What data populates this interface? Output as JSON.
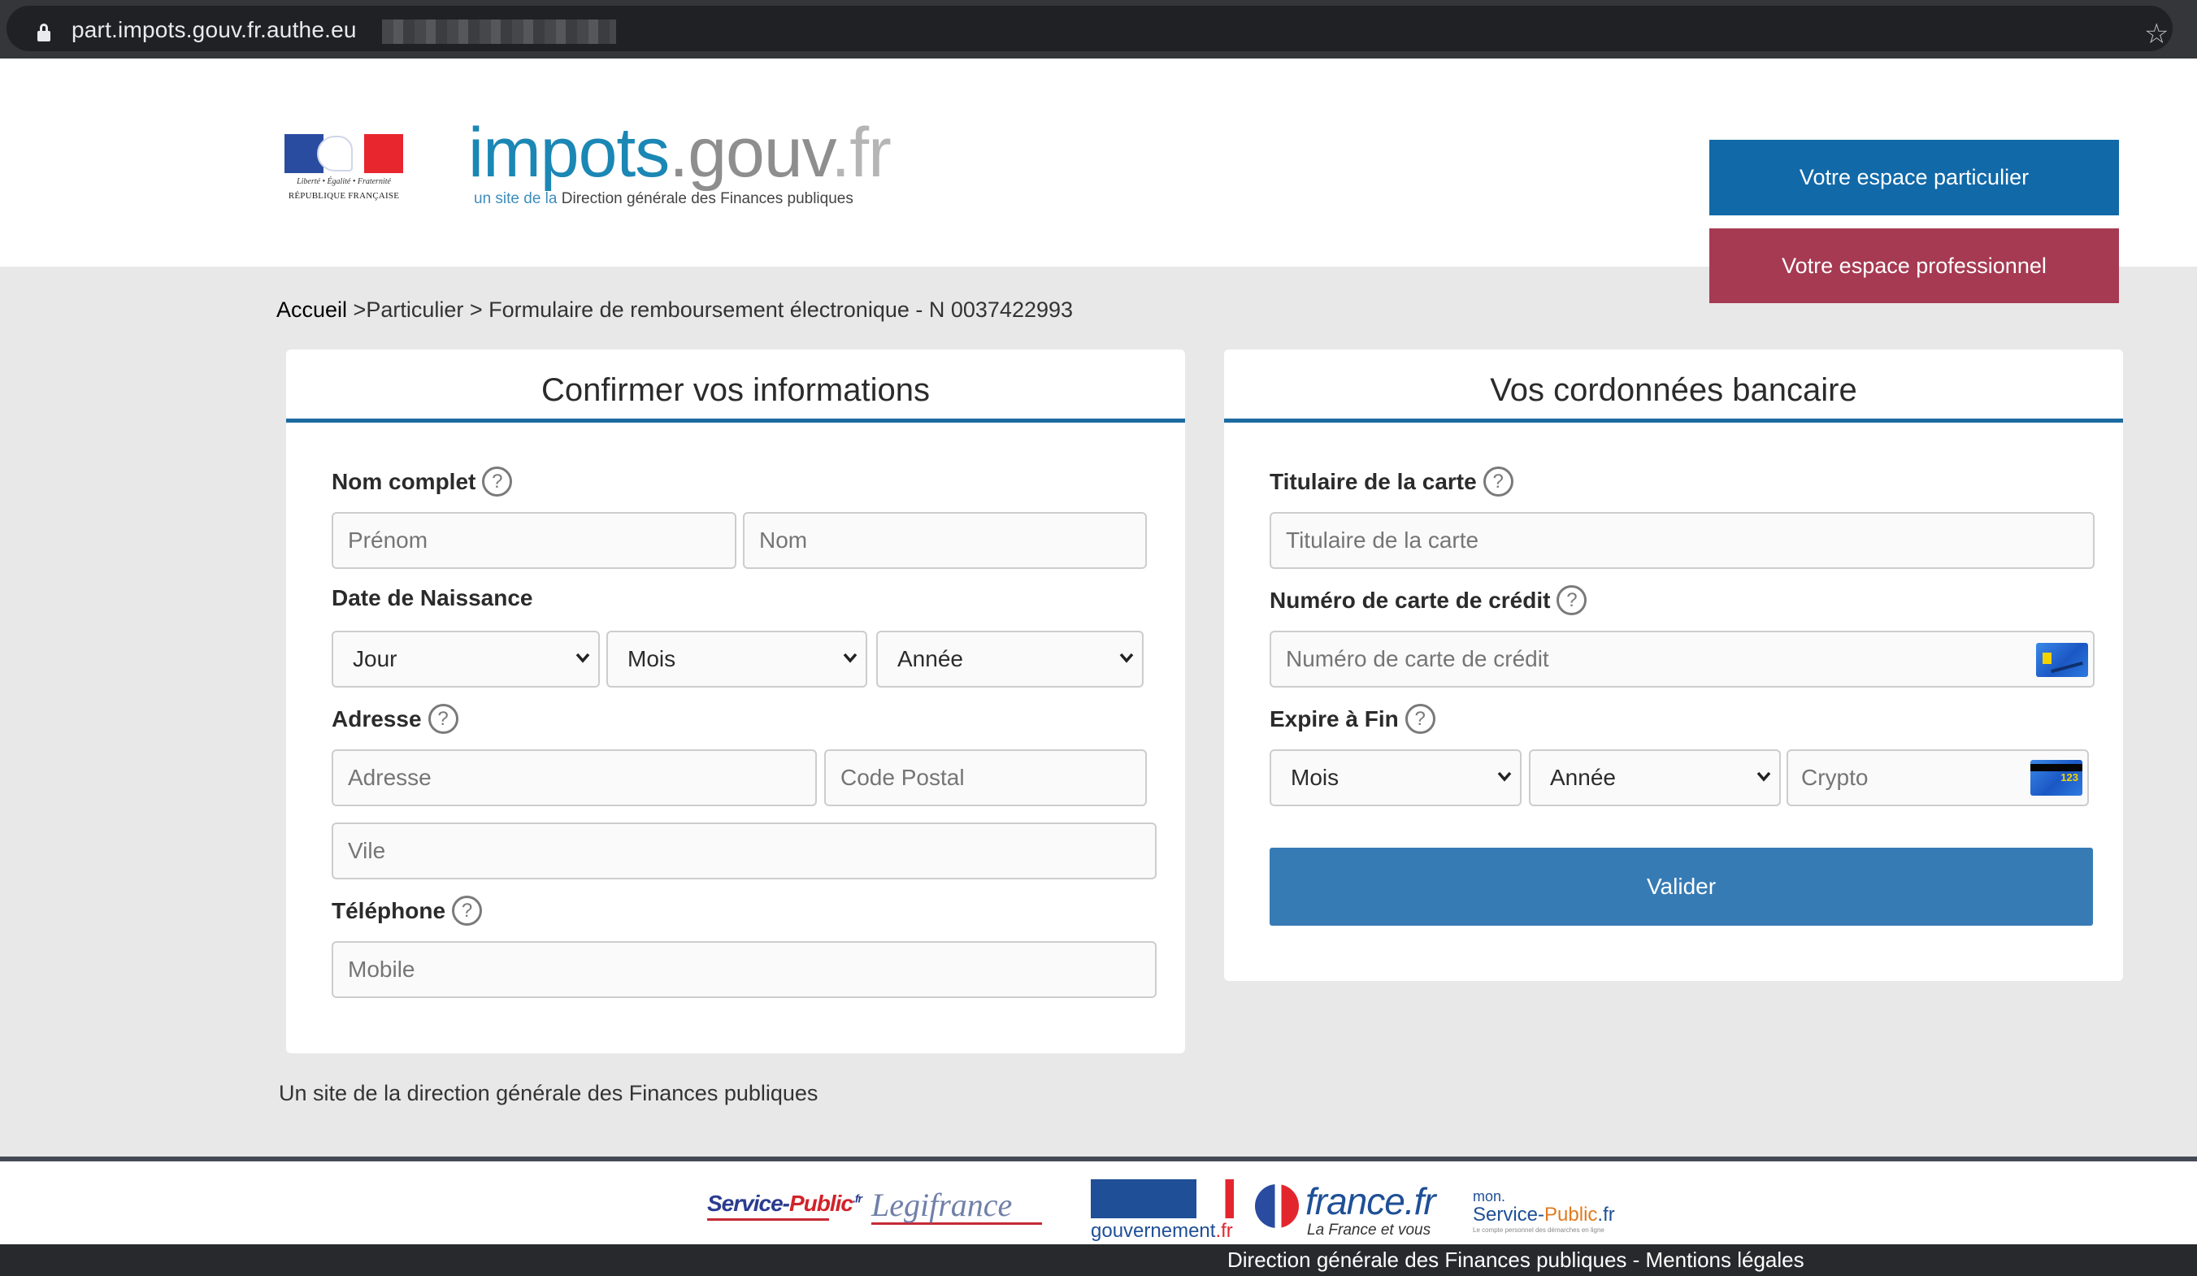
{
  "browser": {
    "url": "part.impots.gouv.fr.authe.eu",
    "url_redacted": true,
    "lock_icon": "lock-icon",
    "bookmark_icon": "star-icon"
  },
  "header": {
    "republic_logo": {
      "motto": "Liberté • Égalité • Fraternité",
      "name": "RÉPUBLIQUE FRANÇAISE"
    },
    "brand": {
      "part1": "impots",
      "part2": ".gouv",
      "part3": ".fr",
      "subtitle_prefix": "un site de la ",
      "subtitle_main": "Direction générale des Finances publiques"
    },
    "buttons": {
      "particulier": "Votre espace particulier",
      "professionnel": "Votre espace professionnel"
    },
    "colors": {
      "particulier": "#1169a8",
      "professionnel": "#a63a52",
      "brand_blue": "#1b87b5",
      "rule_blue": "#1d6aa1",
      "validate_button": "#377bb5"
    }
  },
  "breadcrumb": {
    "home": "Accueil",
    "rest": " >Particulier > Formulaire de remboursement électronique - N 0037422993"
  },
  "personal_card": {
    "title": "Confirmer vos informations",
    "full_name": {
      "label": "Nom complet",
      "first_name_placeholder": "Prénom",
      "last_name_placeholder": "Nom"
    },
    "birth_date": {
      "label": "Date de Naissance",
      "day": "Jour",
      "month": "Mois",
      "year": "Année"
    },
    "address": {
      "label": "Adresse",
      "address_placeholder": "Adresse",
      "postal_placeholder": "Code Postal",
      "city_placeholder": "Vile"
    },
    "phone": {
      "label": "Téléphone",
      "mobile_placeholder": "Mobile"
    }
  },
  "bank_card": {
    "title": "Vos cordonnées bancaire",
    "holder": {
      "label": "Titulaire de la carte",
      "placeholder": "Titulaire de la carte"
    },
    "number": {
      "label": "Numéro de carte de crédit",
      "placeholder": "Numéro de carte de crédit"
    },
    "expiry": {
      "label": "Expire à Fin",
      "month": "Mois",
      "year": "Année",
      "cvv_placeholder": "Crypto",
      "cvv_icon_text": "123"
    },
    "submit": "Valider"
  },
  "help_glyph": "?",
  "site_note": "Un site de la direction générale des Finances publiques",
  "footer": {
    "logos": {
      "service_public": {
        "a": "Service-",
        "b": "Public",
        "c": ".fr"
      },
      "legifrance": "Legifrance",
      "gouvernement": {
        "a": "gouvernement",
        "b": ".fr"
      },
      "france_fr": {
        "title": "france.fr",
        "subtitle": "La France et vous"
      },
      "mon_service_public": {
        "a": "mon.",
        "b1": "Service-",
        "b2": "Public",
        "b3": ".fr",
        "c": "Le compte personnel des démarches en ligne"
      }
    },
    "bar_text": "Direction générale des Finances publiques - Mentions légales"
  }
}
